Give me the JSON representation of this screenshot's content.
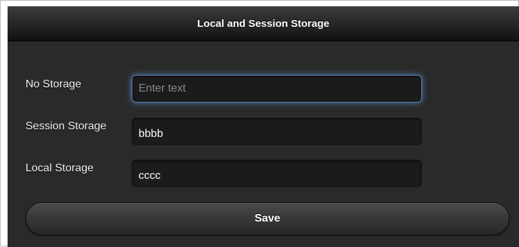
{
  "header": {
    "title": "Local and Session Storage"
  },
  "form": {
    "fields": [
      {
        "label": "No Storage",
        "value": "",
        "placeholder": "Enter text"
      },
      {
        "label": "Session Storage",
        "value": "bbbb",
        "placeholder": ""
      },
      {
        "label": "Local Storage",
        "value": "cccc",
        "placeholder": ""
      }
    ],
    "save_label": "Save"
  },
  "colors": {
    "header_background": "#1a1a1a",
    "content_background": "#2a2a2a",
    "input_background": "#1b1b1b",
    "focus_glow": "#4e82bb",
    "text": "#ffffff"
  }
}
